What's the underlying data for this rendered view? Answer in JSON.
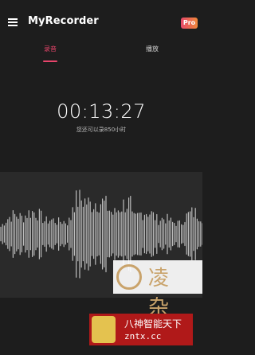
{
  "appbar": {
    "title": "MyRecorder",
    "pro_badge": "Pro"
  },
  "tabs": [
    {
      "label": "录音",
      "active": true
    },
    {
      "label": "播放",
      "active": false
    }
  ],
  "timer": {
    "elapsed": "00:13:27",
    "remaining": "您还可以录850小时"
  },
  "colors": {
    "accent": "#e8456b",
    "background": "#1d1d1d",
    "wave_panel": "#2a2a2a",
    "wave": "#bcbcbc"
  },
  "watermarks": {
    "top_text": "凌 杂",
    "bottom_line1": "八神智能天下",
    "bottom_line2": "zntx.cc"
  },
  "icons": [
    "menu-icon",
    "watermark-seal-icon",
    "watermark-logo-icon"
  ]
}
